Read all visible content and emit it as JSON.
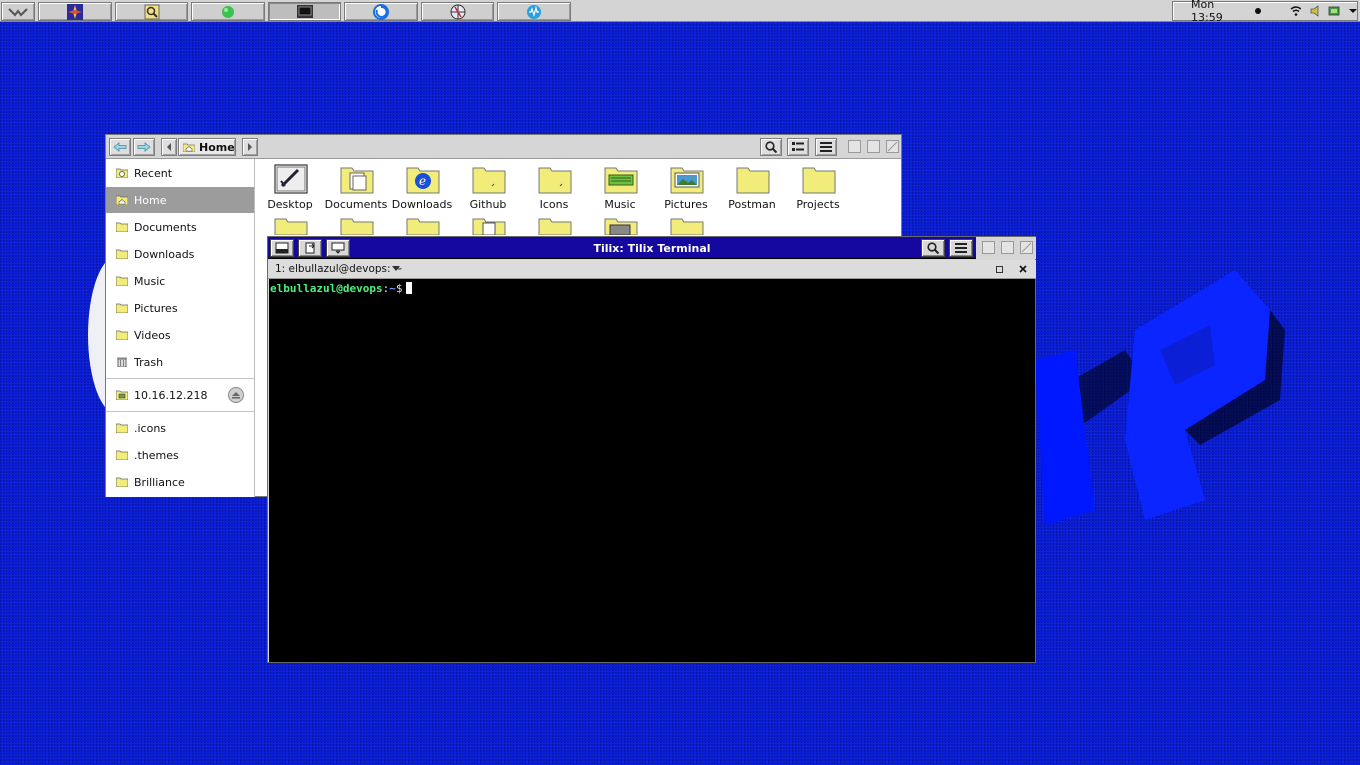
{
  "panel": {
    "clock": "Mon 13:59",
    "tasks": [
      {
        "icon": "logo-icon"
      },
      {
        "icon": "compass-icon"
      },
      {
        "icon": "search-app-icon"
      },
      {
        "icon": "green-ball-icon"
      },
      {
        "icon": "terminal-app-icon",
        "active": true
      },
      {
        "icon": "power-blue-icon"
      },
      {
        "icon": "globe-icon"
      },
      {
        "icon": "audio-icon"
      }
    ]
  },
  "file_manager": {
    "breadcrumb": "Home",
    "sidebar": [
      {
        "label": "Recent",
        "icon": "recent-icon"
      },
      {
        "label": "Home",
        "icon": "home-icon",
        "selected": true
      },
      {
        "label": "Documents",
        "icon": "folder-icon"
      },
      {
        "label": "Downloads",
        "icon": "folder-icon"
      },
      {
        "label": "Music",
        "icon": "folder-icon"
      },
      {
        "label": "Pictures",
        "icon": "folder-icon"
      },
      {
        "label": "Videos",
        "icon": "folder-icon"
      },
      {
        "label": "Trash",
        "icon": "trash-icon"
      },
      {
        "label": "10.16.12.218",
        "icon": "network-drive-icon"
      },
      {
        "label": ".icons",
        "icon": "folder-icon"
      },
      {
        "label": ".themes",
        "icon": "folder-icon"
      },
      {
        "label": "Brilliance",
        "icon": "folder-icon"
      }
    ],
    "files": [
      {
        "label": "Desktop"
      },
      {
        "label": "Documents"
      },
      {
        "label": "Downloads"
      },
      {
        "label": "Github"
      },
      {
        "label": "Icons"
      },
      {
        "label": "Music"
      },
      {
        "label": "Pictures"
      },
      {
        "label": "Postman"
      },
      {
        "label": "Projects"
      }
    ]
  },
  "terminal": {
    "title": "Tilix: Tilix Terminal",
    "session": "1: elbullazul@devops: ~",
    "prompt_user": "elbullazul@devops",
    "prompt_sep": ":",
    "prompt_path": "~",
    "prompt_symbol": "$"
  },
  "colors": {
    "desktop": "#0a1fd6",
    "terminal_title": "#1508a0",
    "prompt_user": "#4ef07a",
    "folder": "#f2ec7a"
  }
}
